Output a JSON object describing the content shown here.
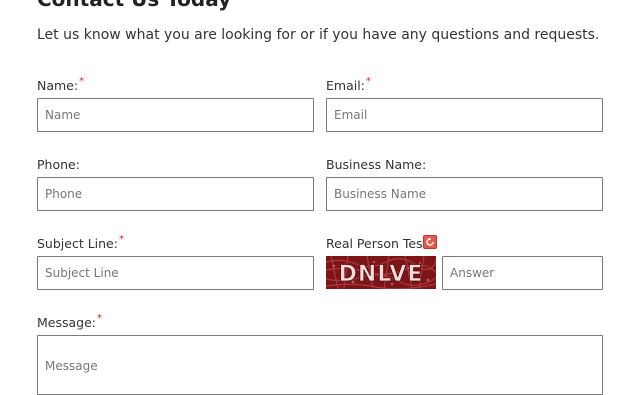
{
  "header": {
    "title": "Contact Us Today",
    "intro": "Let us know what you are looking for or if you have any questions and requests."
  },
  "form": {
    "required_mark": "*",
    "name": {
      "label": "Name:",
      "placeholder": "Name"
    },
    "email": {
      "label": "Email:",
      "placeholder": "Email"
    },
    "phone": {
      "label": "Phone:",
      "placeholder": "Phone"
    },
    "business": {
      "label": "Business Name:",
      "placeholder": "Business Name"
    },
    "subject": {
      "label": "Subject Line:",
      "placeholder": "Subject Line"
    },
    "captcha": {
      "label": "Real Person Test:",
      "placeholder": "Answer",
      "image_text": "DNLVE",
      "refresh_icon": "refresh-icon"
    },
    "message": {
      "label": "Message:",
      "placeholder": "Message"
    }
  },
  "colors": {
    "required": "#d9272e",
    "field_border": "#7a7a7a",
    "captcha_bg": "#7d1418"
  }
}
